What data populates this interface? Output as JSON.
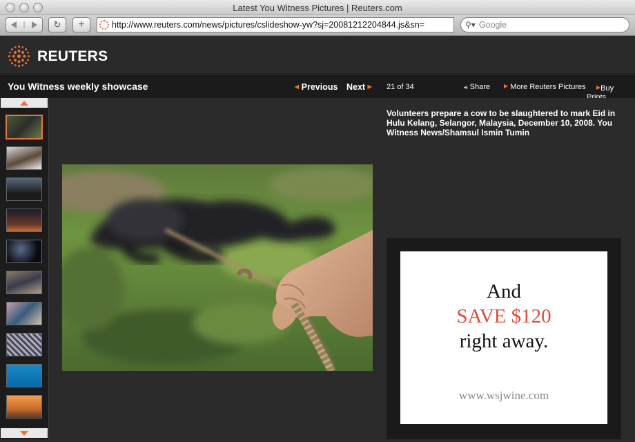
{
  "window": {
    "title": "Latest You Witness Pictures | Reuters.com"
  },
  "toolbar": {
    "url": "http://www.reuters.com/news/pictures/cslideshow-yw?sj=20081212204844.js&sn=",
    "search_placeholder": "Google",
    "reload_glyph": "↻",
    "add_glyph": "+"
  },
  "brand": {
    "name": "REUTERS",
    "accent_color": "#e8733a"
  },
  "showcase": {
    "title": "You Witness weekly showcase",
    "previous_label": "Previous",
    "next_label": "Next",
    "counter": "21 of 34",
    "share_label": "Share",
    "more_pictures_label": "More Reuters Pictures",
    "buy_prints_label": "Buy Prints"
  },
  "photo": {
    "caption": "Volunteers prepare a cow to be slaughtered to mark Eid in Hulu Kelang, Selangor, Malaysia, December 10, 2008. You Witness News/Shamsul Ismin Tumin"
  },
  "ad": {
    "line1": "And",
    "line2": "SAVE $120",
    "line3": "right away.",
    "url": "www.wsjwine.com"
  }
}
